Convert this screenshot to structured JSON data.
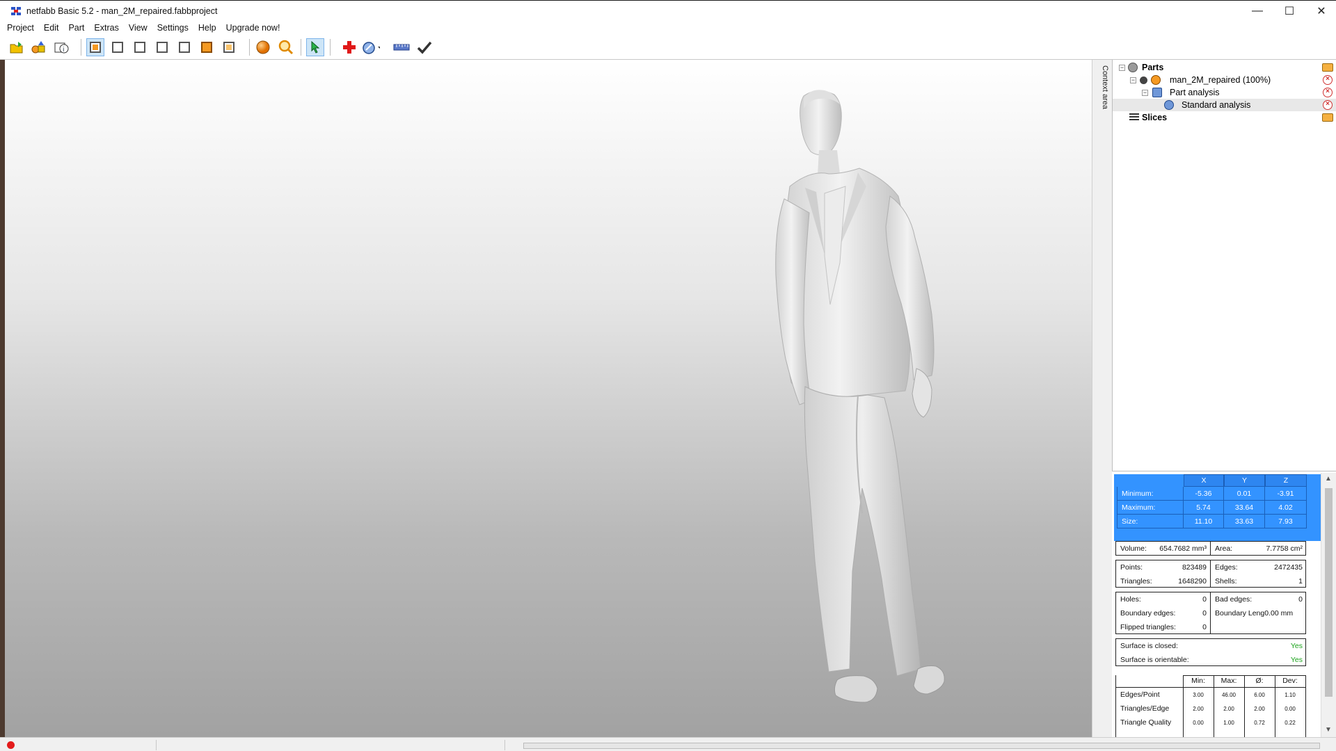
{
  "window": {
    "title": "netfabb Basic 5.2 - man_2M_repaired.fabbproject",
    "controls": {
      "minimize": "—",
      "maximize": "☐",
      "close": "✕"
    }
  },
  "menu": [
    "Project",
    "Edit",
    "Part",
    "Extras",
    "View",
    "Settings",
    "Help",
    "Upgrade now!"
  ],
  "toolbar": {
    "icons": [
      "open-project-icon",
      "add-part-icon",
      "part-info-icon",
      "view-perspective-icon",
      "view-front-icon",
      "view-back-icon",
      "view-left-icon",
      "view-right-icon",
      "view-top-icon",
      "view-bottom-icon",
      "shading-sphere-icon",
      "zoom-icon",
      "select-pointer-icon",
      "repair-cross-icon",
      "measure-dial-icon",
      "ruler-icon",
      "apply-check-icon"
    ]
  },
  "side_tab": {
    "label": "Context area"
  },
  "tree": {
    "parts_label": "Parts",
    "part_label": "man_2M_repaired (100%)",
    "analysis_label": "Part analysis",
    "standard_label": "Standard analysis",
    "slices_label": "Slices"
  },
  "analysis": {
    "axis_headers": [
      "X",
      "Y",
      "Z"
    ],
    "bbox": [
      {
        "label": "Minimum:",
        "values": [
          "-5.36",
          "0.01",
          "-3.91"
        ]
      },
      {
        "label": "Maximum:",
        "values": [
          "5.74",
          "33.64",
          "4.02"
        ]
      },
      {
        "label": "Size:",
        "values": [
          "11.10",
          "33.63",
          "7.93"
        ]
      }
    ],
    "volume_label": "Volume:",
    "volume_value": "654.7682 mm³",
    "area_label": "Area:",
    "area_value": "7.7758 cm²",
    "points_label": "Points:",
    "points_value": "823489",
    "edges_label": "Edges:",
    "edges_value": "2472435",
    "triangles_label": "Triangles:",
    "triangles_value": "1648290",
    "shells_label": "Shells:",
    "shells_value": "1",
    "holes_label": "Holes:",
    "holes_value": "0",
    "bad_edges_label": "Bad edges:",
    "bad_edges_value": "0",
    "boundary_edges_label": "Boundary edges:",
    "boundary_edges_value": "0",
    "boundary_length_label": "Boundary Leng0.00 mm",
    "flipped_label": "Flipped triangles:",
    "flipped_value": "0",
    "closed_label": "Surface is closed:",
    "closed_value": "Yes",
    "orientable_label": "Surface is orientable:",
    "orientable_value": "Yes",
    "stats_headers": [
      "Min:",
      "Max:",
      "Ø:",
      "Dev:"
    ],
    "stats_rows": [
      {
        "label": "Edges/Point",
        "values": [
          "3.00",
          "46.00",
          "6.00",
          "1.10"
        ]
      },
      {
        "label": "Triangles/Edge",
        "values": [
          "2.00",
          "2.00",
          "2.00",
          "0.00"
        ]
      },
      {
        "label": "Triangle Quality",
        "values": [
          "0.00",
          "1.00",
          "0.72",
          "0.22"
        ]
      }
    ]
  },
  "colors": {
    "selection_blue": "#3393ff",
    "status_red": "#e31b1b",
    "yes_green": "#1aa21a"
  }
}
